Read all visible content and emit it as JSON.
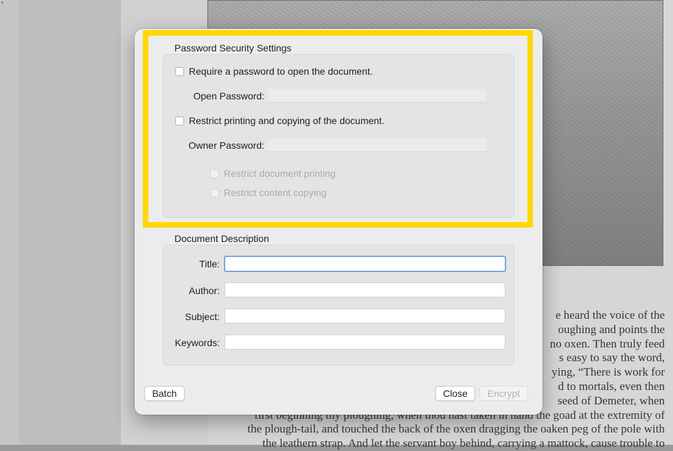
{
  "background": {
    "text_lines": [
      "e heard the voice of the",
      "oughing and points the",
      "no oxen. Then truly feed",
      "s easy to say the word,",
      "ying, “There is work for",
      "d to mortals, even then",
      "seed of Demeter, when",
      "first beginning thy ploughing, when thou hast taken in hand the goad at the extremity of",
      "the plough-tail, and touched the back of the oxen dragging the oaken peg of the pole with",
      "the leathern strap. And let the servant boy behind, carrying a mattock, cause trouble to"
    ]
  },
  "dialog": {
    "password_section": {
      "title": "Password Security Settings",
      "require_open_password": {
        "label": "Require a password to open the document.",
        "checked": false
      },
      "open_password_label": "Open Password:",
      "open_password_value": "",
      "restrict_printing_copying": {
        "label": "Restrict printing and copying of the document.",
        "checked": false
      },
      "owner_password_label": "Owner Password:",
      "owner_password_value": "",
      "restrict_printing": {
        "label": "Restrict document printing",
        "checked": false,
        "enabled": false
      },
      "restrict_copying": {
        "label": "Restrict content copying",
        "checked": false,
        "enabled": false
      }
    },
    "description_section": {
      "title": "Document Description",
      "title_label": "Title:",
      "title_value": "",
      "author_label": "Author:",
      "author_value": "",
      "subject_label": "Subject:",
      "subject_value": "",
      "keywords_label": "Keywords:",
      "keywords_value": ""
    },
    "buttons": {
      "batch": "Batch",
      "close": "Close",
      "encrypt": "Encrypt"
    }
  },
  "colors": {
    "highlight": "#ffd800",
    "focus_ring": "#7aa5e6"
  }
}
